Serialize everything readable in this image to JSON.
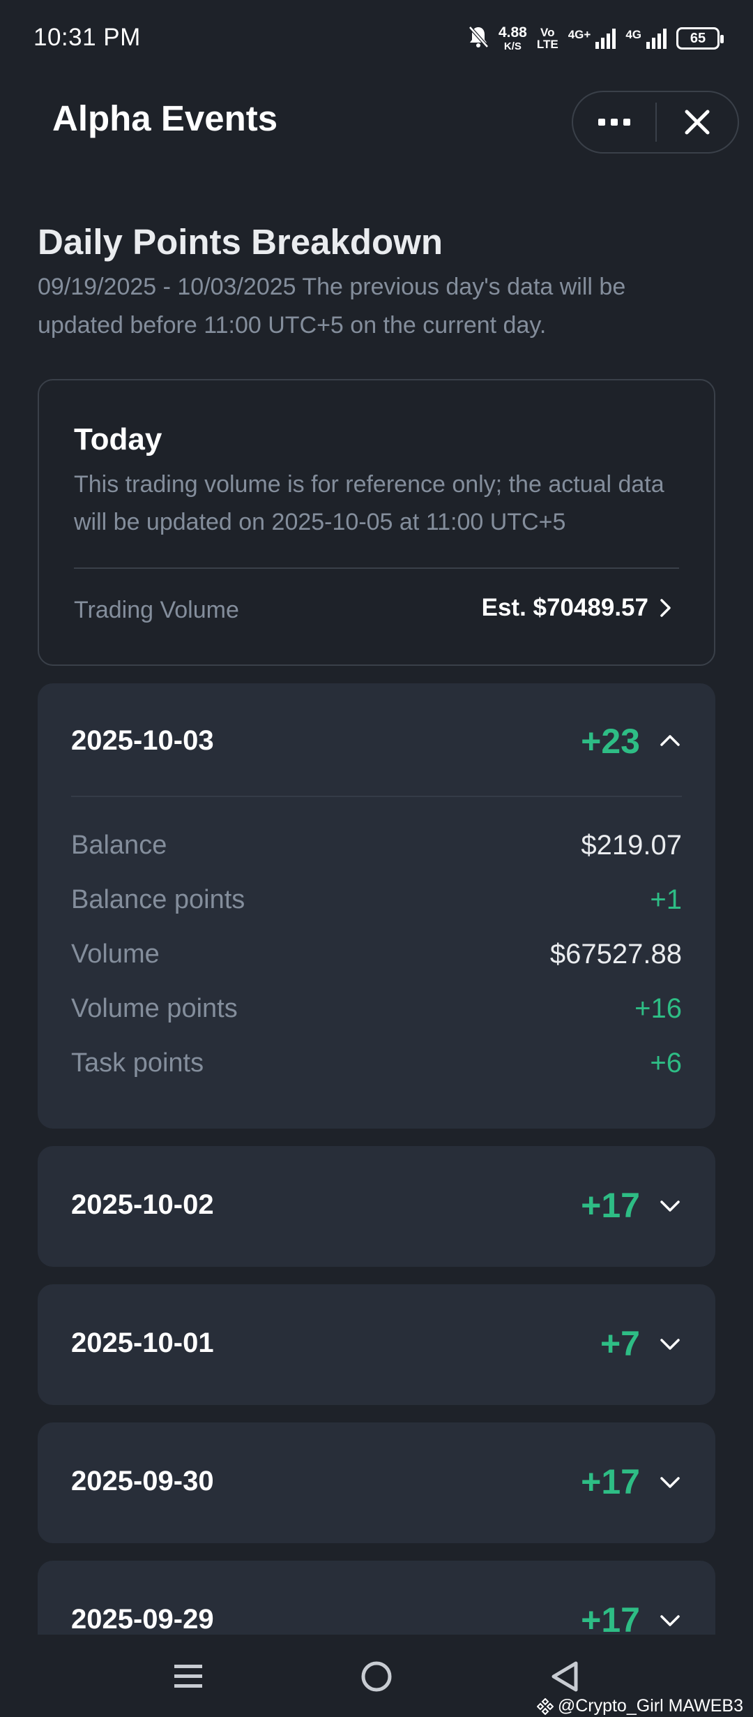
{
  "status_bar": {
    "time": "10:31 PM",
    "net_speed_value": "4.88",
    "net_speed_unit": "K/S",
    "volte_top": "Vo",
    "volte_bottom": "LTE",
    "sim1_label": "4G+",
    "sim2_label": "4G",
    "battery": "65",
    "icons": [
      "bell-muted-icon",
      "signal-icon",
      "signal-icon",
      "battery-icon"
    ]
  },
  "header": {
    "title": "Alpha Events",
    "more_icon": "more-dots-icon",
    "close_icon": "close-icon"
  },
  "section": {
    "title": "Daily Points Breakdown",
    "subtitle": "09/19/2025 - 10/03/2025 The previous day's data will be updated before 11:00 UTC+5 on the current day."
  },
  "today": {
    "title": "Today",
    "description": "This trading volume is for reference only; the actual data will be updated on 2025-10-05 at 11:00 UTC+5",
    "volume_label": "Trading Volume",
    "volume_value": "Est. $70489.57"
  },
  "days": [
    {
      "date": "2025-10-03",
      "points": "+23",
      "expanded": true,
      "details": [
        {
          "label": "Balance",
          "value": "$219.07"
        },
        {
          "label": "Balance points",
          "value": "+1"
        },
        {
          "label": "Volume",
          "value": "$67527.88"
        },
        {
          "label": "Volume points",
          "value": "+16"
        },
        {
          "label": "Task points",
          "value": "+6"
        }
      ]
    },
    {
      "date": "2025-10-02",
      "points": "+17",
      "expanded": false
    },
    {
      "date": "2025-10-01",
      "points": "+7",
      "expanded": false
    },
    {
      "date": "2025-09-30",
      "points": "+17",
      "expanded": false
    },
    {
      "date": "2025-09-29",
      "points": "+17",
      "expanded": false
    }
  ],
  "nav": {
    "icons": [
      "menu-icon",
      "home-icon",
      "back-icon"
    ]
  },
  "watermark": "@Crypto_Girl MAWEB3",
  "colors": {
    "background": "#1e2229",
    "card": "#282e39",
    "positive": "#2ebd85",
    "muted_text": "#848e9c"
  }
}
